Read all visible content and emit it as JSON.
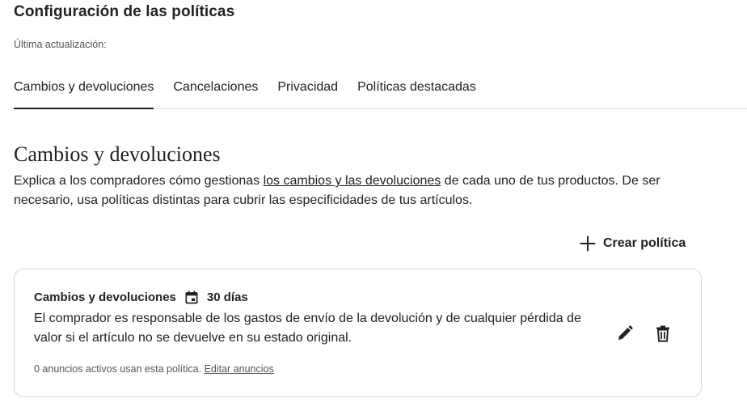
{
  "header": {
    "title": "Configuración de las políticas",
    "last_update_label": "Última actualización:"
  },
  "tabs": [
    {
      "label": "Cambios y devoluciones",
      "active": true
    },
    {
      "label": "Cancelaciones",
      "active": false
    },
    {
      "label": "Privacidad",
      "active": false
    },
    {
      "label": "Políticas destacadas",
      "active": false
    }
  ],
  "section": {
    "title": "Cambios y devoluciones",
    "desc_before": "Explica a los compradores cómo gestionas ",
    "desc_link": "los cambios y las devoluciones",
    "desc_after": " de cada uno de tus productos. De ser necesario, usa políticas distintas para cubrir las especificidades de tus artículos."
  },
  "create_button": {
    "label": "Crear política",
    "icon": "plus-icon"
  },
  "policy_card": {
    "title": "Cambios y devoluciones",
    "days_icon": "calendar-icon",
    "days": "30 días",
    "description": "El comprador es responsable de los gastos de envío de la devolución y de cualquier pérdida de valor si el artículo no se devuelve en su estado original.",
    "footer_text": "0 anuncios activos usan esta política.",
    "footer_link": "Editar anuncios",
    "edit_icon": "pencil-icon",
    "delete_icon": "trash-icon"
  }
}
